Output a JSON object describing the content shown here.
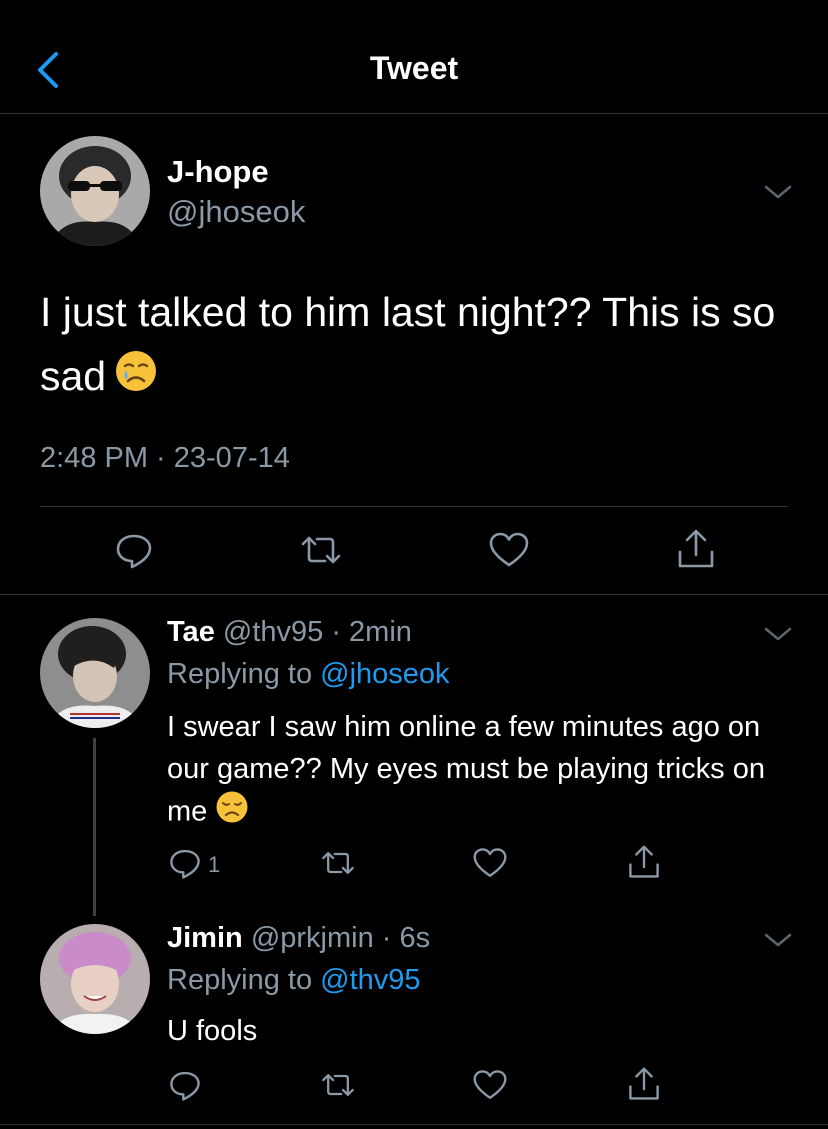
{
  "header": {
    "title": "Tweet"
  },
  "main_tweet": {
    "name": "J-hope",
    "handle": "@jhoseok",
    "text": "I just talked to him last night?? This is so sad",
    "emoji": "crying-face-emoji",
    "timestamp": "2:48 PM · 23-07-14"
  },
  "replies": [
    {
      "name": "Tae",
      "meta": "@thv95 · 2min",
      "replying_prefix": "Replying to",
      "replying_to": "@jhoseok",
      "text": "I swear I saw him online a few minutes ago on our game?? My eyes must be playing tricks on me",
      "emoji": "disappointed-face-emoji",
      "reply_count": "1"
    },
    {
      "name": "Jimin",
      "meta": "@prkjmin · 6s",
      "replying_prefix": "Replying to",
      "replying_to": "@thv95",
      "text": "U fools"
    }
  ],
  "icons": {
    "back": "chevron-left-icon",
    "more": "chevron-down-icon",
    "reply": "speech-bubble-icon",
    "retweet": "retweet-icon",
    "like": "heart-icon",
    "share": "share-icon"
  },
  "colors": {
    "background": "#000000",
    "accent": "#1d9bf0",
    "muted": "#8b98a5",
    "divider": "#2f3336"
  }
}
